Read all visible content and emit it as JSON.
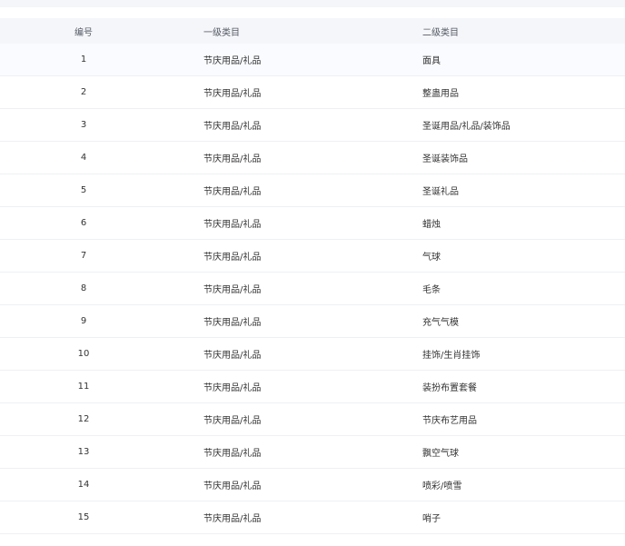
{
  "table": {
    "headers": {
      "id": "编号",
      "level1": "一级类目",
      "level2": "二级类目"
    },
    "rows": [
      {
        "id": "1",
        "level1": "节庆用品/礼品",
        "level2": "面具"
      },
      {
        "id": "2",
        "level1": "节庆用品/礼品",
        "level2": "整蛊用品"
      },
      {
        "id": "3",
        "level1": "节庆用品/礼品",
        "level2": "圣诞用品/礼品/装饰品"
      },
      {
        "id": "4",
        "level1": "节庆用品/礼品",
        "level2": "圣诞装饰品"
      },
      {
        "id": "5",
        "level1": "节庆用品/礼品",
        "level2": "圣诞礼品"
      },
      {
        "id": "6",
        "level1": "节庆用品/礼品",
        "level2": "蜡烛"
      },
      {
        "id": "7",
        "level1": "节庆用品/礼品",
        "level2": "气球"
      },
      {
        "id": "8",
        "level1": "节庆用品/礼品",
        "level2": "毛条"
      },
      {
        "id": "9",
        "level1": "节庆用品/礼品",
        "level2": "充气气模"
      },
      {
        "id": "10",
        "level1": "节庆用品/礼品",
        "level2": "挂饰/生肖挂饰"
      },
      {
        "id": "11",
        "level1": "节庆用品/礼品",
        "level2": "装扮布置套餐"
      },
      {
        "id": "12",
        "level1": "节庆用品/礼品",
        "level2": "节庆布艺用品"
      },
      {
        "id": "13",
        "level1": "节庆用品/礼品",
        "level2": "飘空气球"
      },
      {
        "id": "14",
        "level1": "节庆用品/礼品",
        "level2": "喷彩/喷雪"
      },
      {
        "id": "15",
        "level1": "节庆用品/礼品",
        "level2": "哨子"
      }
    ]
  }
}
